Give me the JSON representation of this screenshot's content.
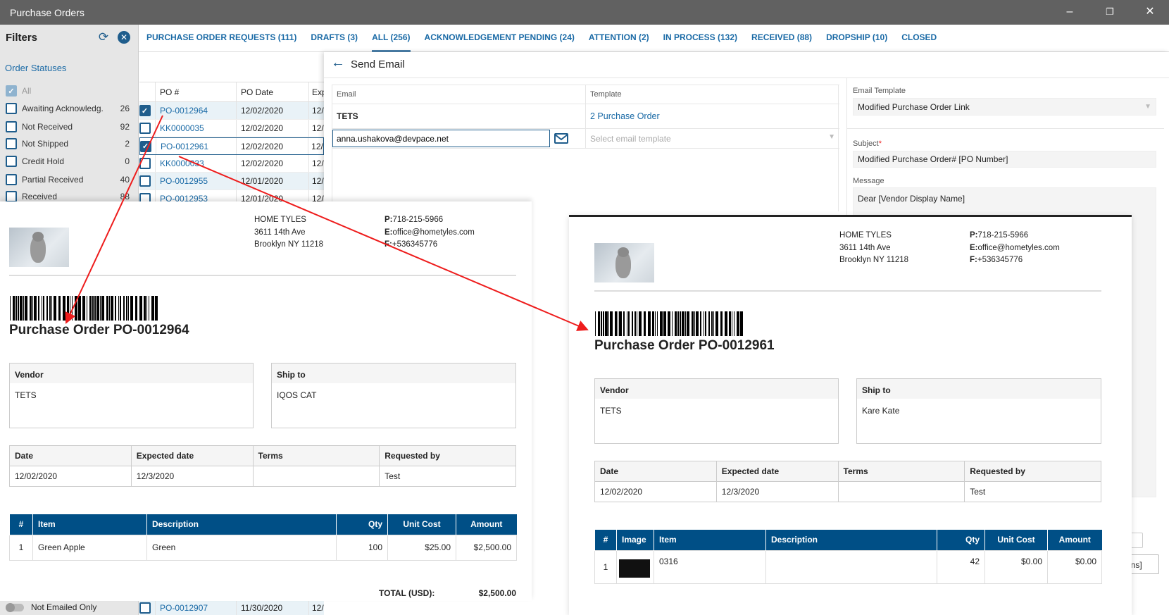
{
  "window": {
    "title": "Purchase Orders"
  },
  "filters": {
    "title": "Filters",
    "section": "Order Statuses",
    "items": [
      {
        "label": "All",
        "count": "",
        "state": "disabled-checked"
      },
      {
        "label": "Awaiting Acknowledg.",
        "count": "26",
        "state": "unchecked"
      },
      {
        "label": "Not Received",
        "count": "92",
        "state": "unchecked"
      },
      {
        "label": "Not Shipped",
        "count": "2",
        "state": "unchecked"
      },
      {
        "label": "Credit Hold",
        "count": "0",
        "state": "unchecked"
      },
      {
        "label": "Partial Received",
        "count": "40",
        "state": "unchecked"
      },
      {
        "label": "Received",
        "count": "88",
        "state": "unchecked"
      }
    ],
    "toggle_label": "Not Emailed Only"
  },
  "tabs": [
    {
      "label": "PURCHASE ORDER REQUESTS (111)",
      "active": false
    },
    {
      "label": "DRAFTS (3)",
      "active": false
    },
    {
      "label": "ALL (256)",
      "active": true
    },
    {
      "label": "ACKNOWLEDGEMENT PENDING (24)",
      "active": false
    },
    {
      "label": "ATTENTION (2)",
      "active": false
    },
    {
      "label": "IN PROCESS (132)",
      "active": false
    },
    {
      "label": "RECEIVED (88)",
      "active": false
    },
    {
      "label": "DROPSHIP (10)",
      "active": false
    },
    {
      "label": "CLOSED",
      "active": false
    }
  ],
  "grid": {
    "headers": [
      "PO #",
      "PO Date",
      "Exp"
    ],
    "rows": [
      {
        "po": "PO-0012964",
        "date": "12/02/2020",
        "exp": "12/",
        "checked": true
      },
      {
        "po": "KK0000035",
        "date": "12/02/2020",
        "exp": "12/",
        "checked": false
      },
      {
        "po": "PO-0012961",
        "date": "12/02/2020",
        "exp": "12/",
        "checked": true
      },
      {
        "po": "KK0000033",
        "date": "12/02/2020",
        "exp": "12/",
        "checked": false
      },
      {
        "po": "PO-0012955",
        "date": "12/01/2020",
        "exp": "12/",
        "checked": false
      },
      {
        "po": "PO-0012953",
        "date": "12/01/2020",
        "exp": "12/",
        "checked": false
      }
    ],
    "bottom_row": {
      "po": "PO-0012907",
      "date": "11/30/2020",
      "exp": "12/",
      "checked": false
    }
  },
  "send_email": {
    "title": "Send Email",
    "col_email": "Email",
    "col_template": "Template",
    "vendor": "TETS",
    "template_link": "2 Purchase Order",
    "email_value": "anna.ushakova@devpace.net",
    "template_placeholder": "Select email template",
    "email_template_label": "Email Template",
    "email_template_value": "Modified Purchase Order Link",
    "subject_label": "Subject",
    "subject_value": "Modified Purchase Order# [PO Number]",
    "message_label": "Message",
    "message_value": "Dear [Vendor Display Name]",
    "partial_button": "tions]"
  },
  "invoices": [
    {
      "company": [
        "HOME TYLES",
        "3611 14th Ave",
        "Brooklyn NY 11218"
      ],
      "contacts": [
        {
          "k": "P:",
          "v": "718-215-5966"
        },
        {
          "k": "E:",
          "v": "office@hometyles.com"
        },
        {
          "k": "F:",
          "v": "+536345776"
        }
      ],
      "title": "Purchase Order PO-0012964",
      "vendor_label": "Vendor",
      "vendor": "TETS",
      "ship_label": "Ship to",
      "ship": "IQOS CAT",
      "info_headers": [
        "Date",
        "Expected date",
        "Terms",
        "Requested by"
      ],
      "info_values": [
        "12/02/2020",
        "12/3/2020",
        "",
        "Test"
      ],
      "item_headers": [
        "#",
        "Item",
        "Description",
        "Qty",
        "Unit Cost",
        "Amount"
      ],
      "items": [
        [
          "1",
          "Green Apple",
          "Green",
          "100",
          "$25.00",
          "$2,500.00"
        ]
      ],
      "total_label": "TOTAL (USD):",
      "total": "$2,500.00"
    },
    {
      "company": [
        "HOME TYLES",
        "3611 14th Ave",
        "Brooklyn NY 11218"
      ],
      "contacts": [
        {
          "k": "P:",
          "v": "718-215-5966"
        },
        {
          "k": "E:",
          "v": "office@hometyles.com"
        },
        {
          "k": "F:",
          "v": "+536345776"
        }
      ],
      "title": "Purchase Order PO-0012961",
      "vendor_label": "Vendor",
      "vendor": "TETS",
      "ship_label": "Ship to",
      "ship": "Kare Kate",
      "info_headers": [
        "Date",
        "Expected date",
        "Terms",
        "Requested by"
      ],
      "info_values": [
        "12/02/2020",
        "12/3/2020",
        "",
        "Test"
      ],
      "item_headers": [
        "#",
        "Image",
        "Item",
        "Description",
        "Qty",
        "Unit Cost",
        "Amount"
      ],
      "items": [
        [
          "1",
          "",
          "0316",
          "",
          "42",
          "$0.00",
          "$0.00"
        ]
      ]
    }
  ],
  "colors": {
    "accent": "#1a6aa6",
    "table_header": "#004f86",
    "arrow": "#ee1c1c",
    "titlebar": "#616161"
  }
}
